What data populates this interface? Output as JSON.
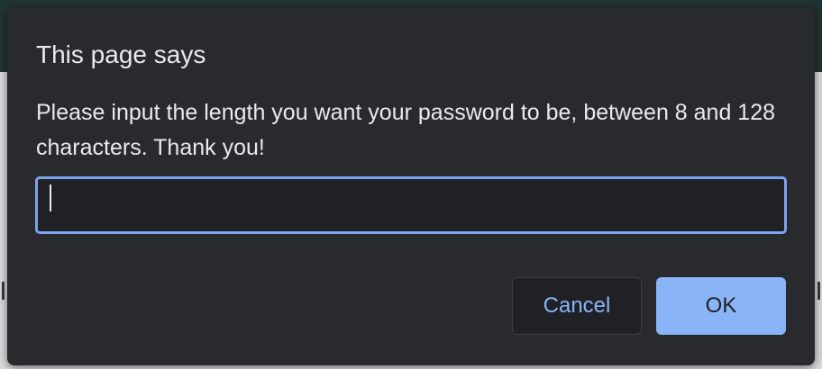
{
  "dialog": {
    "title": "This page says",
    "message": "Please input the length you want your password to be, between 8 and 128 characters. Thank you!",
    "input": {
      "value": "",
      "placeholder": ""
    },
    "cancel_label": "Cancel",
    "ok_label": "OK"
  },
  "colors": {
    "dialog_background": "#292a2d",
    "input_focus_border": "#7da2f0",
    "primary_button": "#8ab4f8",
    "cancel_text": "#8ab4f8"
  }
}
